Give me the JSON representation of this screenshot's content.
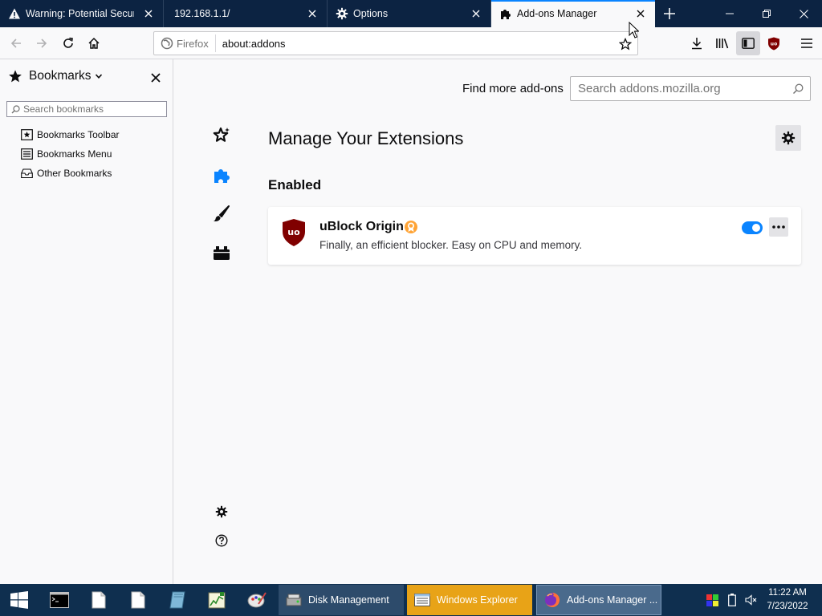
{
  "tabs": [
    {
      "title": "Warning: Potential Security",
      "icon": "warning-icon",
      "selected": false
    },
    {
      "title": "192.168.1.1/",
      "icon": "",
      "selected": false
    },
    {
      "title": "Options",
      "icon": "gear-icon",
      "selected": false
    },
    {
      "title": "Add-ons Manager",
      "icon": "puzzle-icon",
      "selected": true
    }
  ],
  "navbar": {
    "identity_label": "Firefox",
    "url": "about:addons"
  },
  "sidebar": {
    "title": "Bookmarks",
    "search_placeholder": "Search bookmarks",
    "items": [
      {
        "label": "Bookmarks Toolbar",
        "icon": "bookmarks-toolbar-icon"
      },
      {
        "label": "Bookmarks Menu",
        "icon": "bookmarks-menu-icon"
      },
      {
        "label": "Other Bookmarks",
        "icon": "other-bookmarks-icon"
      }
    ]
  },
  "addons": {
    "find_more_label": "Find more add-ons",
    "search_placeholder": "Search addons.mozilla.org",
    "page_title": "Manage Your Extensions",
    "section_enabled": "Enabled",
    "extension": {
      "name": "uBlock Origin",
      "description": "Finally, an efficient blocker. Easy on CPU and memory.",
      "enabled": true,
      "badge": "recommended-badge-icon"
    },
    "categories": [
      "recommendations-icon",
      "extensions-icon",
      "themes-icon",
      "plugins-icon"
    ]
  },
  "taskbar": {
    "tasks": [
      {
        "label": "Disk Management",
        "icon": "disk-management-icon"
      },
      {
        "label": "Windows Explorer",
        "icon": "explorer-icon"
      },
      {
        "label": "Add-ons Manager ...",
        "icon": "firefox-icon"
      }
    ],
    "clock_time": "11:22 AM",
    "clock_date": "7/23/2022"
  },
  "colors": {
    "tabstrip": "#0c2342",
    "accent": "#0a84ff",
    "taskbar": "#0f2f4f",
    "explorer_task": "#e8a317",
    "ublock_red": "#800000"
  }
}
